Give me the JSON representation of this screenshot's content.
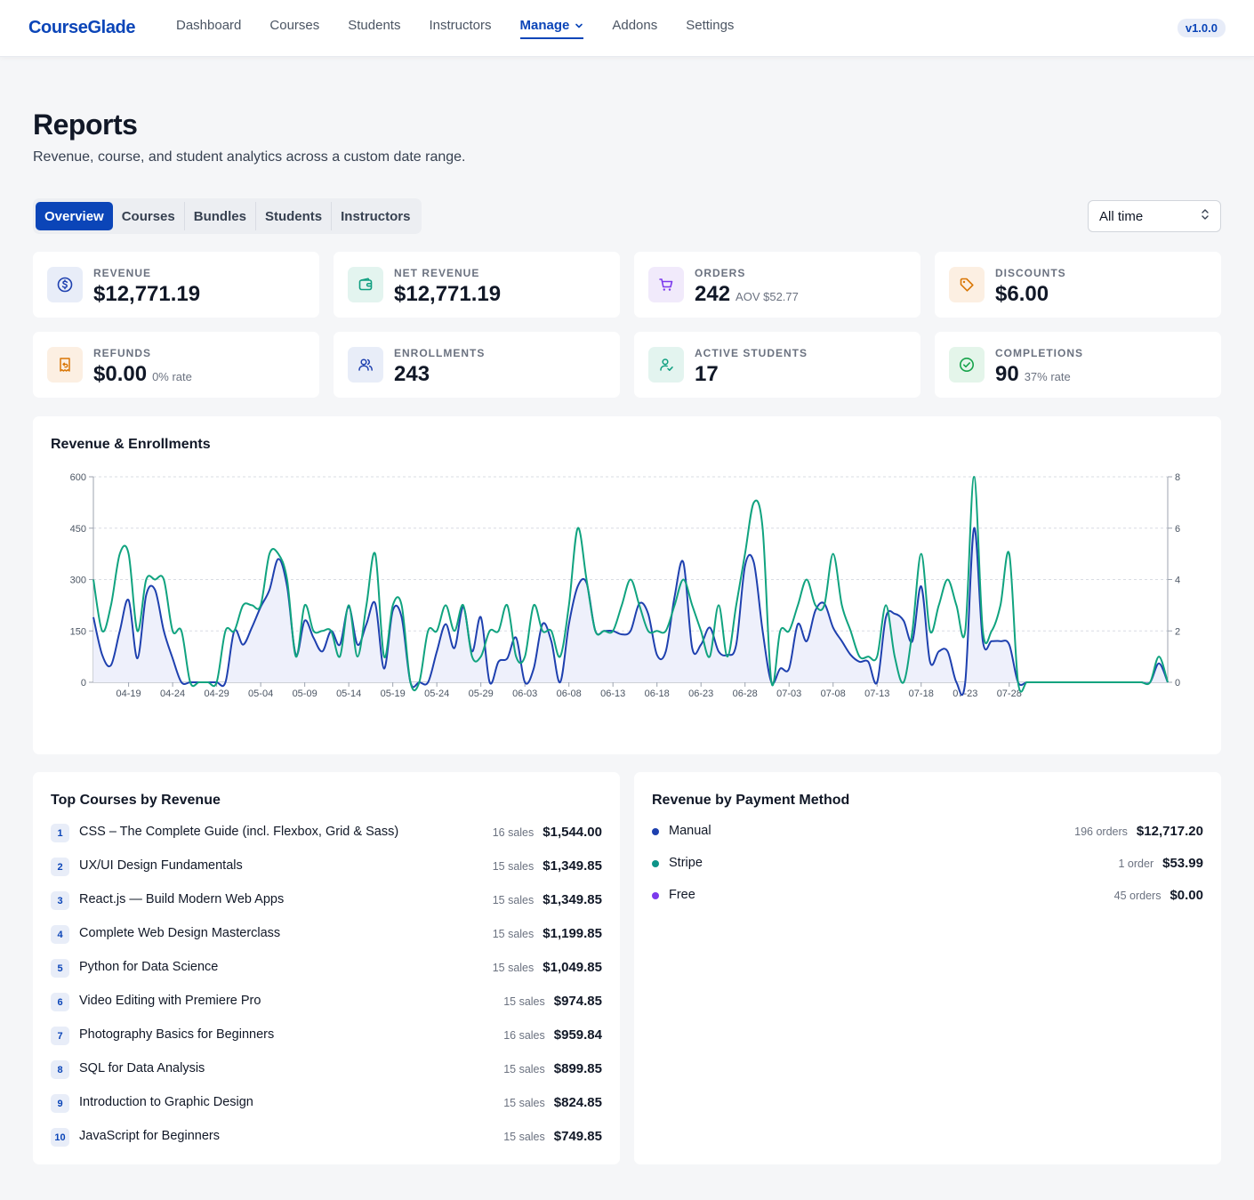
{
  "app": {
    "logo": "CourseGlade",
    "version": "v1.0.0"
  },
  "nav": [
    {
      "label": "Dashboard",
      "active": false
    },
    {
      "label": "Courses",
      "active": false
    },
    {
      "label": "Students",
      "active": false
    },
    {
      "label": "Instructors",
      "active": false
    },
    {
      "label": "Manage",
      "active": true,
      "has_dropdown": true
    },
    {
      "label": "Addons",
      "active": false
    },
    {
      "label": "Settings",
      "active": false
    }
  ],
  "header": {
    "title": "Reports",
    "subtitle": "Revenue, course, and student analytics across a custom date range."
  },
  "tabs": [
    "Overview",
    "Courses",
    "Bundles",
    "Students",
    "Instructors"
  ],
  "active_tab": "Overview",
  "date_range": {
    "selected": "All time"
  },
  "stats": [
    {
      "label": "REVENUE",
      "value": "$12,771.19",
      "extra": "",
      "icon": "dollar-icon",
      "color": "#1e40af",
      "bg": "#e8edf8"
    },
    {
      "label": "NET REVENUE",
      "value": "$12,771.19",
      "extra": "",
      "icon": "wallet-icon",
      "color": "#0f9f80",
      "bg": "#e3f4ef"
    },
    {
      "label": "ORDERS",
      "value": "242",
      "extra": "AOV $52.77",
      "icon": "cart-icon",
      "color": "#7c3aed",
      "bg": "#f1eafb"
    },
    {
      "label": "DISCOUNTS",
      "value": "$6.00",
      "extra": "",
      "icon": "tag-icon",
      "color": "#d97706",
      "bg": "#fcefe2"
    },
    {
      "label": "REFUNDS",
      "value": "$0.00",
      "extra": "0% rate",
      "icon": "refund-receipt-icon",
      "color": "#d97706",
      "bg": "#fcefe2"
    },
    {
      "label": "ENROLLMENTS",
      "value": "243",
      "extra": "",
      "icon": "users-icon",
      "color": "#1e40af",
      "bg": "#e8edf8"
    },
    {
      "label": "ACTIVE STUDENTS",
      "value": "17",
      "extra": "",
      "icon": "user-check-icon",
      "color": "#0f9f80",
      "bg": "#e3f4ef"
    },
    {
      "label": "COMPLETIONS",
      "value": "90",
      "extra": "37% rate",
      "icon": "check-circle-icon",
      "color": "#16a34a",
      "bg": "#e4f5ea"
    }
  ],
  "chart": {
    "title": "Revenue & Enrollments"
  },
  "chart_data": {
    "type": "line",
    "title": "Revenue & Enrollments",
    "start_date": "2024-04-15",
    "x_tick_labels": [
      "04-19",
      "04-24",
      "04-29",
      "05-04",
      "05-09",
      "05-14",
      "05-19",
      "05-24",
      "05-29",
      "06-03",
      "06-08",
      "06-13",
      "06-18",
      "06-23",
      "06-28",
      "07-03",
      "07-08",
      "07-13",
      "07-18",
      "07-23",
      "07-28"
    ],
    "x_tick_first_index": 4,
    "x_tick_step": 5,
    "y_left": {
      "min": 0,
      "max": 600,
      "ticks": [
        0,
        150,
        300,
        450,
        600
      ]
    },
    "y_right": {
      "min": 0,
      "max": 8,
      "ticks": [
        0,
        2,
        4,
        6,
        8
      ]
    },
    "grid": true,
    "series": [
      {
        "name": "Revenue",
        "axis": "left",
        "color": "#1e40af",
        "fill": "#eef0fb",
        "values": [
          190,
          80,
          50,
          150,
          240,
          70,
          255,
          270,
          150,
          70,
          0,
          0,
          0,
          0,
          0,
          0,
          150,
          110,
          160,
          220,
          270,
          360,
          280,
          80,
          180,
          130,
          90,
          150,
          110,
          220,
          110,
          170,
          230,
          40,
          210,
          190,
          0,
          0,
          0,
          90,
          170,
          100,
          220,
          90,
          190,
          0,
          60,
          70,
          130,
          0,
          40,
          170,
          120,
          0,
          170,
          280,
          290,
          150,
          150,
          150,
          140,
          150,
          230,
          200,
          80,
          90,
          250,
          350,
          100,
          110,
          160,
          90,
          80,
          110,
          340,
          350,
          150,
          0,
          40,
          40,
          170,
          120,
          210,
          230,
          160,
          120,
          80,
          60,
          60,
          0,
          190,
          200,
          180,
          120,
          280,
          60,
          90,
          90,
          0,
          0,
          450,
          120,
          120,
          120,
          110,
          0,
          0,
          0,
          0,
          0,
          0,
          0,
          0,
          0,
          0,
          0,
          0,
          0,
          0,
          0,
          0,
          55,
          0
        ]
      },
      {
        "name": "Enrollments",
        "axis": "right",
        "color": "#10a37f",
        "values": [
          4,
          2,
          3,
          5,
          5,
          2,
          4,
          4,
          4,
          2,
          2,
          0,
          0,
          0,
          0,
          2,
          2,
          3,
          3,
          3,
          5,
          5,
          4,
          1,
          3,
          2,
          2,
          2,
          1,
          3,
          1,
          3,
          5,
          1,
          3,
          3,
          0,
          0,
          2,
          2,
          3,
          2,
          3,
          1,
          1,
          2,
          2,
          3,
          1,
          1,
          3,
          2,
          2,
          1,
          3,
          6,
          4,
          2,
          2,
          2,
          3,
          4,
          3,
          2,
          2,
          2,
          3,
          4,
          3,
          2,
          1,
          3,
          1,
          3,
          5,
          7,
          6,
          0,
          2,
          2,
          3,
          4,
          3,
          3,
          5,
          3,
          2,
          1,
          1,
          1,
          3,
          1,
          0,
          2,
          5,
          2,
          3,
          4,
          3,
          2,
          8,
          2,
          2,
          3,
          5,
          0,
          0,
          0,
          0,
          0,
          0,
          0,
          0,
          0,
          0,
          0,
          0,
          0,
          0,
          0,
          0,
          1,
          0
        ]
      }
    ]
  },
  "top_courses": {
    "title": "Top Courses by Revenue",
    "rows": [
      {
        "rank": "1",
        "name": "CSS – The Complete Guide (incl. Flexbox, Grid & Sass)",
        "sales": "16 sales",
        "amount": "$1,544.00"
      },
      {
        "rank": "2",
        "name": "UX/UI Design Fundamentals",
        "sales": "15 sales",
        "amount": "$1,349.85"
      },
      {
        "rank": "3",
        "name": "React.js — Build Modern Web Apps",
        "sales": "15 sales",
        "amount": "$1,349.85"
      },
      {
        "rank": "4",
        "name": "Complete Web Design Masterclass",
        "sales": "15 sales",
        "amount": "$1,199.85"
      },
      {
        "rank": "5",
        "name": "Python for Data Science",
        "sales": "15 sales",
        "amount": "$1,049.85"
      },
      {
        "rank": "6",
        "name": "Video Editing with Premiere Pro",
        "sales": "15 sales",
        "amount": "$974.85"
      },
      {
        "rank": "7",
        "name": "Photography Basics for Beginners",
        "sales": "16 sales",
        "amount": "$959.84"
      },
      {
        "rank": "8",
        "name": "SQL for Data Analysis",
        "sales": "15 sales",
        "amount": "$899.85"
      },
      {
        "rank": "9",
        "name": "Introduction to Graphic Design",
        "sales": "15 sales",
        "amount": "$824.85"
      },
      {
        "rank": "10",
        "name": "JavaScript for Beginners",
        "sales": "15 sales",
        "amount": "$749.85"
      }
    ]
  },
  "payment_methods": {
    "title": "Revenue by Payment Method",
    "rows": [
      {
        "name": "Manual",
        "orders": "196 orders",
        "amount": "$12,717.20",
        "color": "#1e40af"
      },
      {
        "name": "Stripe",
        "orders": "1 order",
        "amount": "$53.99",
        "color": "#0d9488"
      },
      {
        "name": "Free",
        "orders": "45 orders",
        "amount": "$0.00",
        "color": "#7c3aed"
      }
    ]
  }
}
